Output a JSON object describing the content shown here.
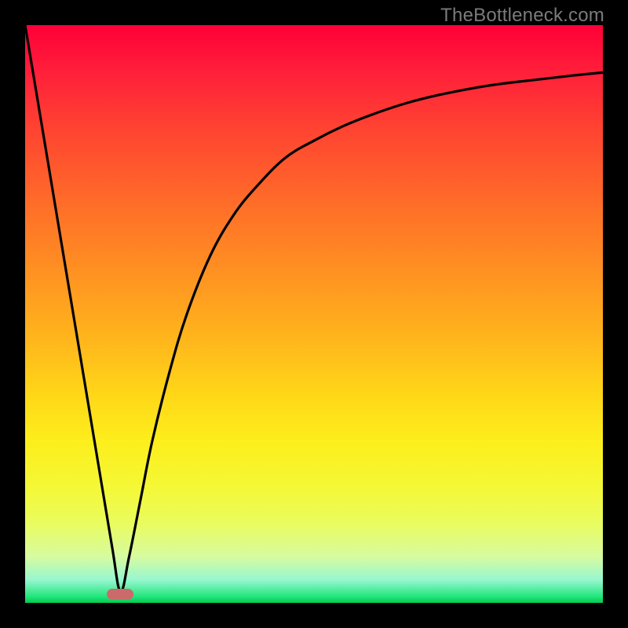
{
  "watermark": "TheBottleneck.com",
  "colors": {
    "curve": "#000000",
    "marker": "#cb6a6b",
    "background_top": "#ff0037",
    "background_bottom": "#05c94e",
    "frame": "#000000"
  },
  "chart_data": {
    "type": "line",
    "title": "",
    "xlabel": "",
    "ylabel": "",
    "xlim": [
      0,
      100
    ],
    "ylim": [
      0,
      100
    ],
    "grid": false,
    "legend": false,
    "annotations": [],
    "marker": {
      "x": 16.5,
      "y": 1.5
    },
    "series": [
      {
        "name": "bottleneck-curve",
        "x": [
          0,
          4,
          8,
          12,
          15,
          16.5,
          18,
          20,
          22,
          25,
          28,
          32,
          36,
          40,
          45,
          50,
          55,
          60,
          66,
          72,
          80,
          88,
          95,
          100
        ],
        "y": [
          100,
          76,
          52,
          28,
          10,
          2,
          8,
          18,
          28,
          40,
          50,
          60,
          67,
          72,
          77,
          80,
          82.5,
          84.5,
          86.5,
          88,
          89.5,
          90.5,
          91.3,
          91.8
        ]
      }
    ]
  }
}
